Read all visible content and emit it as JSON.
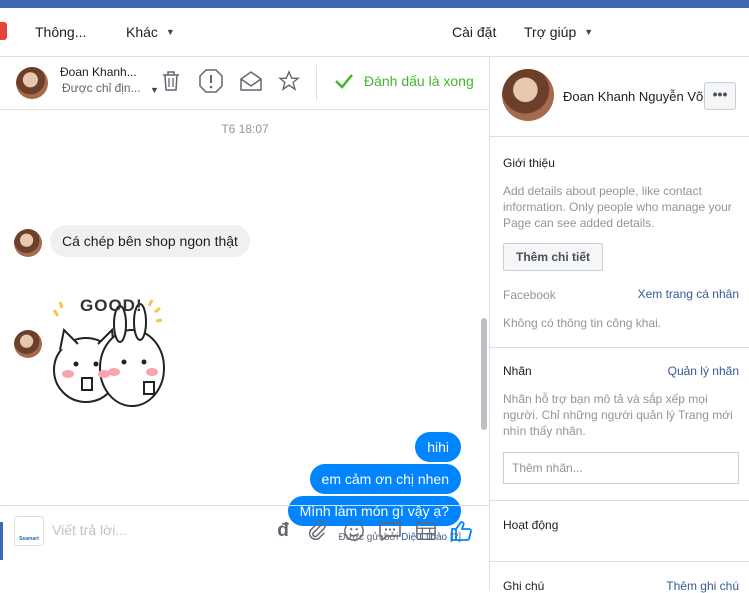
{
  "nav": {
    "info": "Thông...",
    "other": "Khác",
    "settings": "Cài đặt",
    "help": "Trợ giúp"
  },
  "conversation": {
    "name": "Đoan Khanh...",
    "assigned": "Được chỉ địn...",
    "mark_done": "Đánh dấu là xong",
    "time": "T6 18:07",
    "incoming": "Cá chép bên shop ngon thật",
    "sticker_text": "GOOD!",
    "outgoing": [
      "hihi",
      "em cảm ơn chị nhen",
      "Mình làm món gì vậy ạ?"
    ],
    "sent_by_prefix": "Được gửi bởi",
    "sent_by_name": "Diệu Thảo",
    "sent_by_help": "[?]",
    "composer_placeholder": "Viết trả lời...",
    "shop_logo": "Seamart"
  },
  "profile": {
    "full_name": "Đoan Khanh Nguyễn Võ",
    "more": "•••",
    "intro_title": "Giới thiệu",
    "intro_text": "Add details about people, like contact information. Only people who manage your Page can see added details.",
    "add_details": "Thêm chi tiết",
    "facebook_label": "Facebook",
    "view_profile": "Xem trang cá nhân",
    "no_public_info": "Không có thông tin công khai.",
    "labels_title": "Nhãn",
    "manage_labels": "Quản lý nhãn",
    "labels_text": "Nhãn hỗ trợ bạn mô tả và sắp xếp mọi người. Chỉ những người quản lý Trang mới nhìn thấy nhãn.",
    "add_label_placeholder": "Thêm nhãn...",
    "activity_title": "Hoạt động",
    "notes_title": "Ghi chú",
    "add_note": "Thêm ghi chú"
  },
  "colors": {
    "accent": "#4267b2",
    "outgoing_bubble": "#0084ff",
    "done_green": "#42b72a",
    "link": "#365899"
  }
}
